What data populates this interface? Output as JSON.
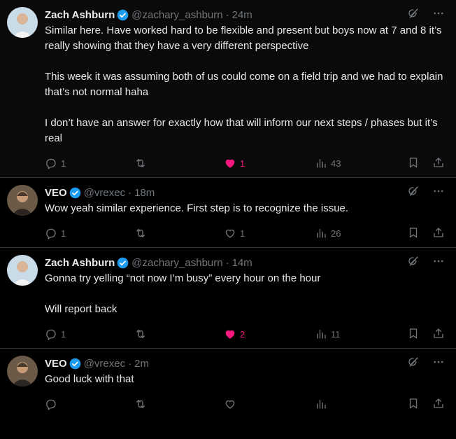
{
  "tweets": [
    {
      "name": "Zach Ashburn",
      "handle": "@zachary_ashburn",
      "separator": "·",
      "time": "24m",
      "text": "Similar here. Have worked hard to be flexible and present but boys now at 7 and 8 it’s really showing that they have a very different perspective\n\nThis week it was assuming both of us could come on a field trip and we had to explain that’s not normal haha\n\nI don’t have an answer for exactly how that will inform our next steps / phases but it’s real",
      "replies": "1",
      "reposts": "",
      "likes": "1",
      "liked": true,
      "views": "43"
    },
    {
      "name": "VEO",
      "handle": "@vrexec",
      "separator": "·",
      "time": "18m",
      "text": "Wow yeah similar experience. First step is to recognize the issue.",
      "replies": "1",
      "reposts": "",
      "likes": "1",
      "liked": false,
      "views": "26"
    },
    {
      "name": "Zach Ashburn",
      "handle": "@zachary_ashburn",
      "separator": "·",
      "time": "14m",
      "text": "Gonna try yelling “not now I’m busy” every hour on the hour\n\nWill report back",
      "replies": "1",
      "reposts": "",
      "likes": "2",
      "liked": true,
      "views": "11"
    },
    {
      "name": "VEO",
      "handle": "@vrexec",
      "separator": "·",
      "time": "2m",
      "text": "Good luck with that",
      "replies": "",
      "reposts": "",
      "likes": "",
      "liked": false,
      "views": ""
    }
  ],
  "colors": {
    "background": "#000000",
    "text": "#e7e9ea",
    "muted": "#71767b",
    "verified": "#1d9bf0",
    "like_active": "#f91880",
    "divider": "#2f3336"
  },
  "icons": [
    "grok-icon",
    "more-icon",
    "reply-icon",
    "repost-icon",
    "heart-icon",
    "views-icon",
    "bookmark-icon",
    "share-icon",
    "verified-badge-icon"
  ]
}
